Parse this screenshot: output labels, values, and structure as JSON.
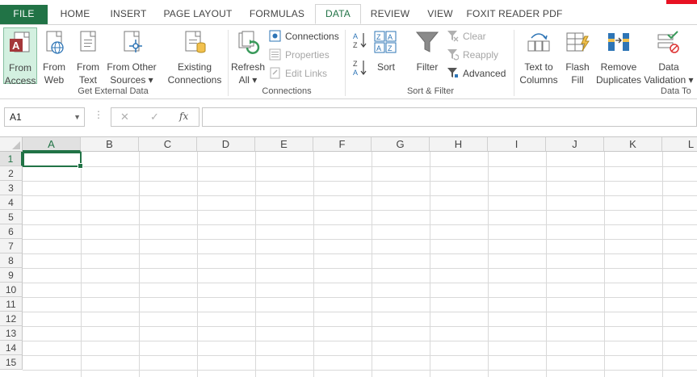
{
  "tabs": {
    "file": "FILE",
    "home": "HOME",
    "insert": "INSERT",
    "page_layout": "PAGE LAYOUT",
    "formulas": "FORMULAS",
    "data": "DATA",
    "review": "REVIEW",
    "view": "VIEW",
    "foxit": "FOXIT READER PDF"
  },
  "ribbon": {
    "get_external": {
      "from_access": [
        "From",
        "Access"
      ],
      "from_web": [
        "From",
        "Web"
      ],
      "from_text": [
        "From",
        "Text"
      ],
      "from_other": [
        "From Other",
        "Sources ▾"
      ],
      "existing": [
        "Existing",
        "Connections"
      ],
      "group_label": "Get External Data"
    },
    "connections": {
      "refresh": [
        "Refresh",
        "All ▾"
      ],
      "connections": "Connections",
      "properties": "Properties",
      "edit_links": "Edit Links",
      "group_label": "Connections"
    },
    "sort_filter": {
      "sort": "Sort",
      "filter": "Filter",
      "clear": "Clear",
      "reapply": "Reapply",
      "advanced": "Advanced",
      "group_label": "Sort & Filter"
    },
    "data_tools": {
      "text_to_columns": [
        "Text to",
        "Columns"
      ],
      "flash_fill": [
        "Flash",
        "Fill"
      ],
      "remove_duplicates": [
        "Remove",
        "Duplicates"
      ],
      "data_validation": [
        "Data",
        "Validation ▾"
      ],
      "group_label": "Data To"
    }
  },
  "formula_bar": {
    "name_box": "A1",
    "cancel": "✕",
    "enter": "✓",
    "fx": "fx",
    "value": ""
  },
  "grid": {
    "columns": [
      "A",
      "B",
      "C",
      "D",
      "E",
      "F",
      "G",
      "H",
      "I",
      "J",
      "K",
      "L"
    ],
    "rows": [
      "1",
      "2",
      "3",
      "4",
      "5",
      "6",
      "7",
      "8",
      "9",
      "10",
      "11",
      "12",
      "13",
      "14",
      "15"
    ],
    "selected_cell": "A1"
  },
  "colors": {
    "accent": "#217346",
    "selection_fill": "#d3f0e0",
    "disabled": "#a6a6a6"
  }
}
